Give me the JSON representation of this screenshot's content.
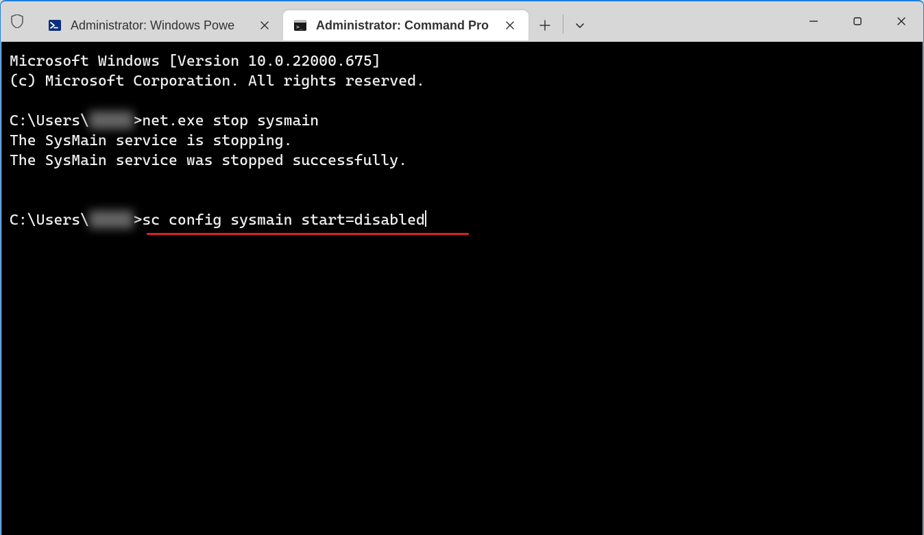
{
  "tabs": [
    {
      "label": "Administrator: Windows Powe",
      "icon": "powershell-icon",
      "active": false
    },
    {
      "label": "Administrator: Command Pro",
      "icon": "cmd-icon",
      "active": true
    }
  ],
  "terminal": {
    "banner_line1": "Microsoft Windows [Version 10.0.22000.675]",
    "banner_line2": "(c) Microsoft Corporation. All rights reserved.",
    "prompt_prefix": "C:\\Users\\",
    "prompt_user_masked": "█████",
    "prompt_gt": ">",
    "cmd1": "net.exe stop sysmain",
    "out1_line1": "The SysMain service is stopping.",
    "out1_line2": "The SysMain service was stopped successfully.",
    "cmd2": "sc config sysmain start=disabled"
  },
  "annotation": {
    "color": "#e02020"
  }
}
